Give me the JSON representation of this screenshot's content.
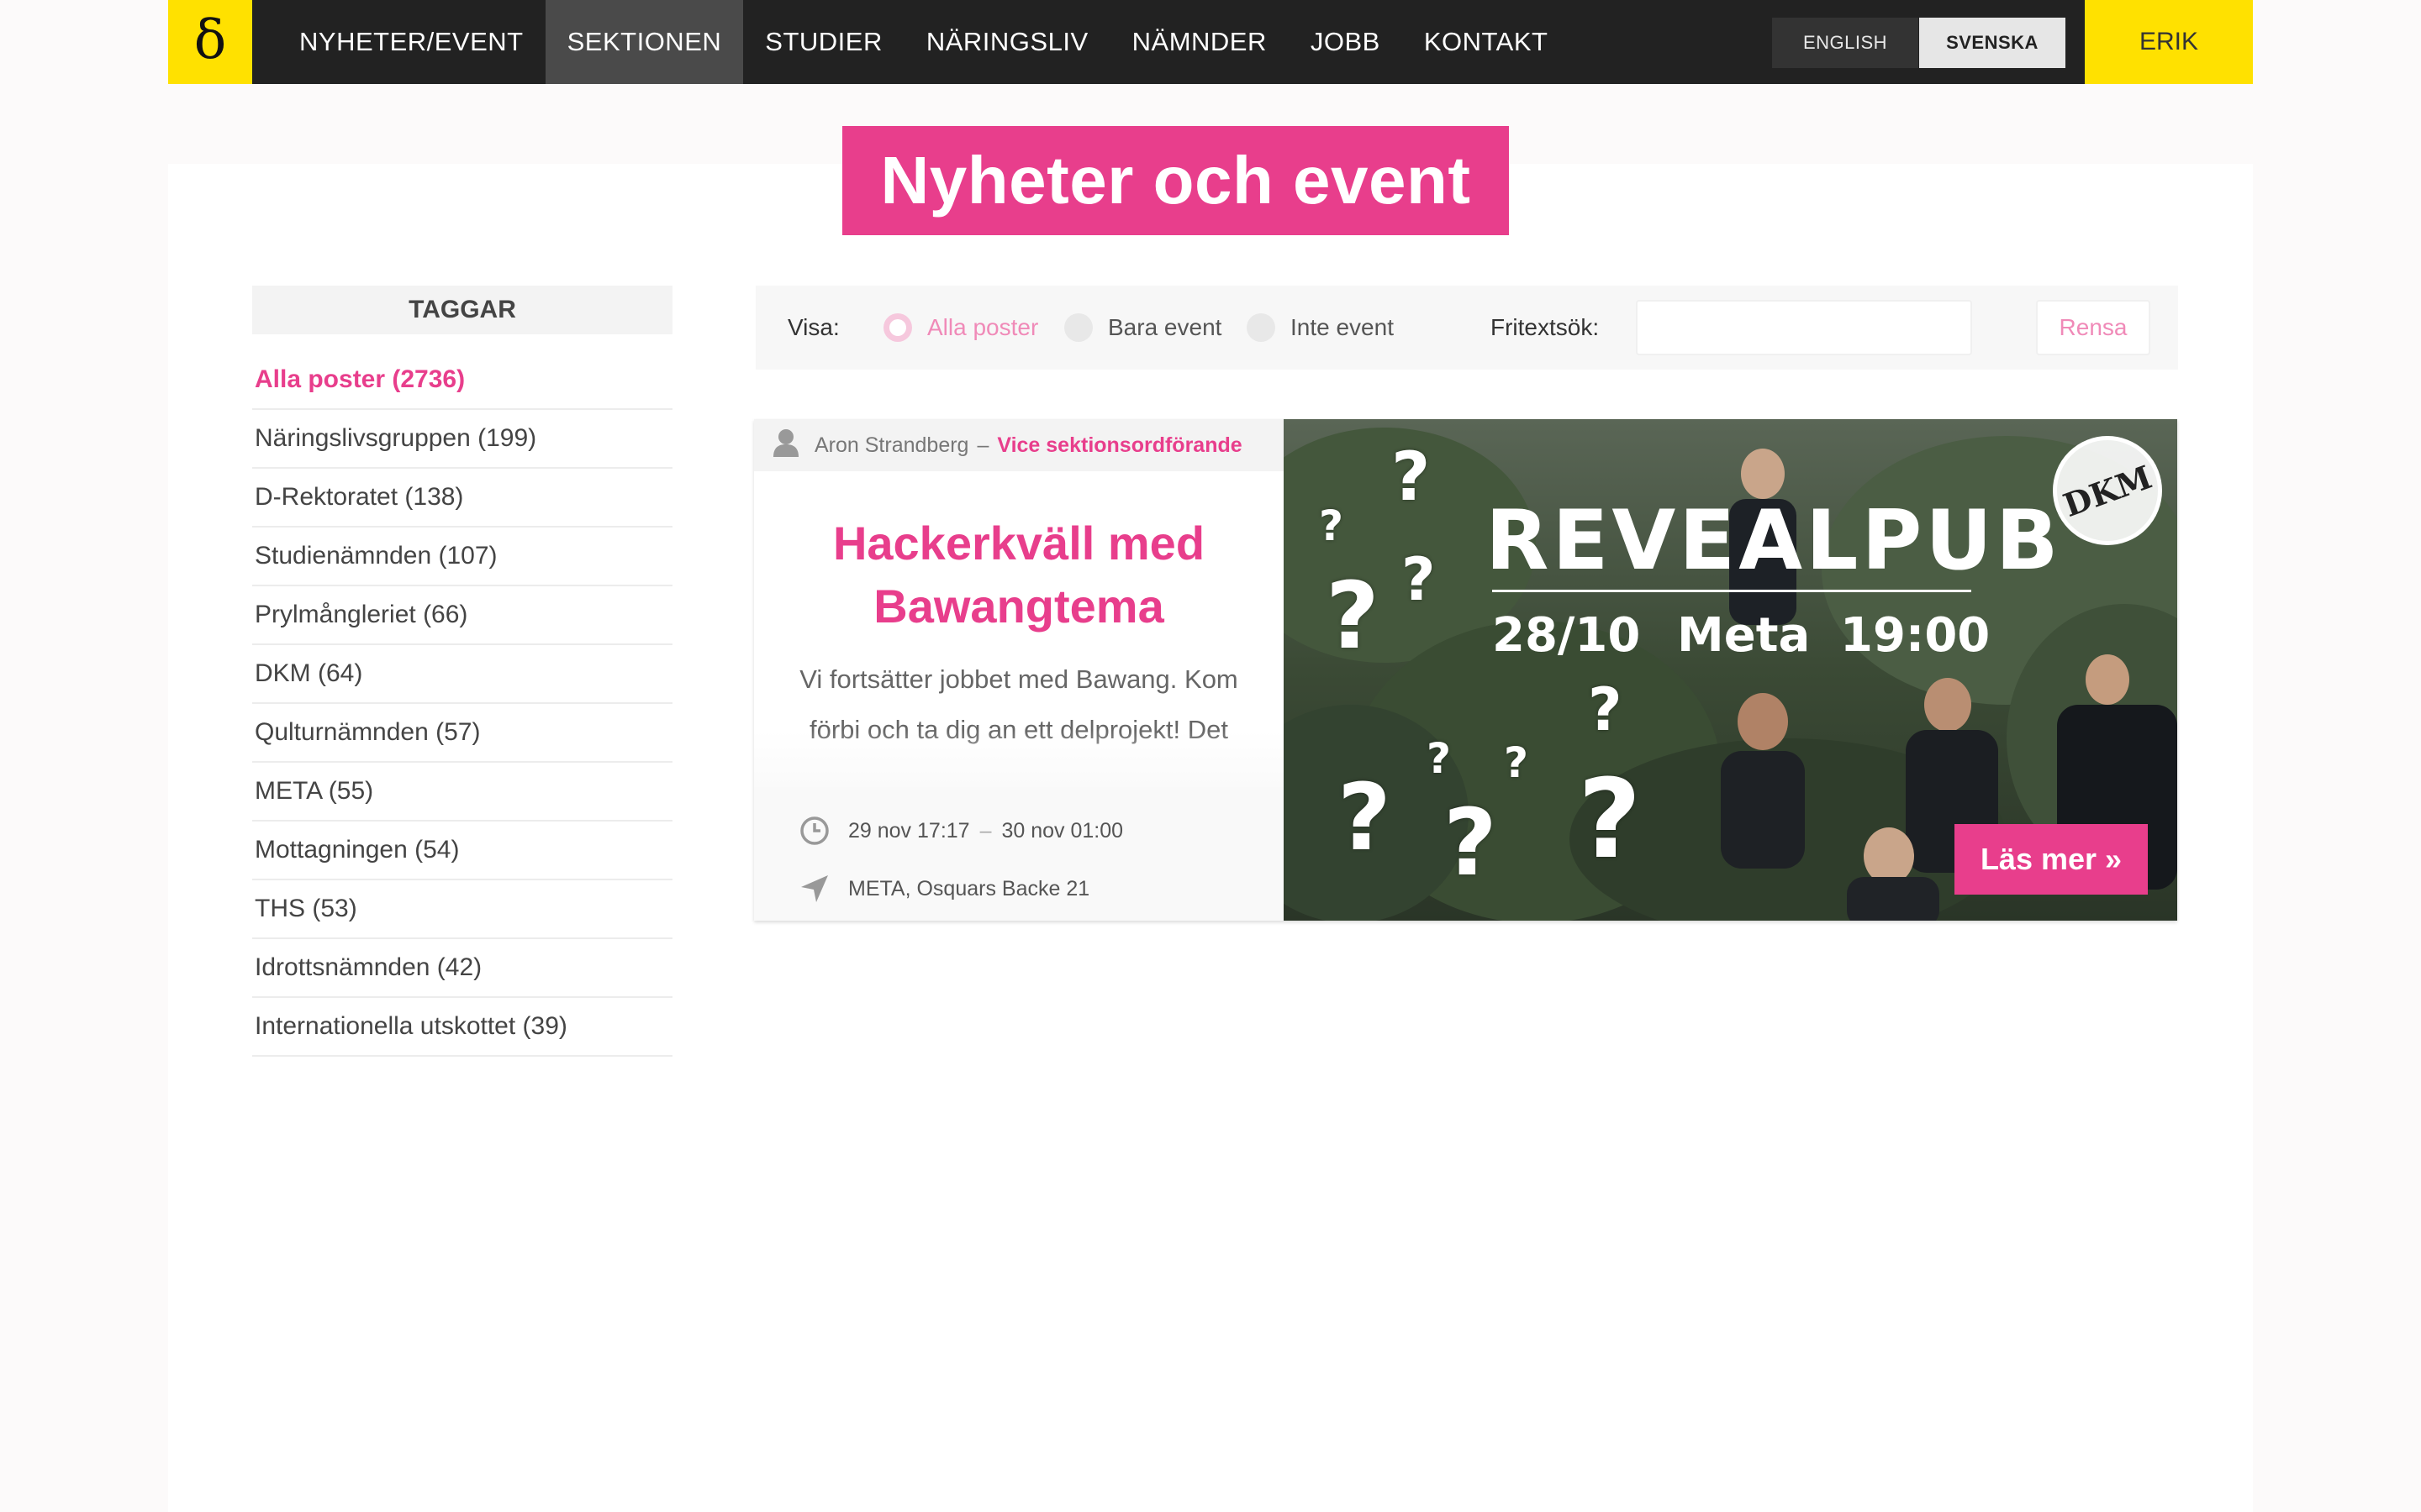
{
  "nav": {
    "logo": "δ",
    "items": [
      {
        "label": "NYHETER/EVENT",
        "active": false
      },
      {
        "label": "SEKTIONEN",
        "active": true
      },
      {
        "label": "STUDIER",
        "active": false
      },
      {
        "label": "NÄRINGSLIV",
        "active": false
      },
      {
        "label": "NÄMNDER",
        "active": false
      },
      {
        "label": "JOBB",
        "active": false
      },
      {
        "label": "KONTAKT",
        "active": false
      }
    ],
    "lang_en": "ENGLISH",
    "lang_sv": "SVENSKA",
    "user": "ERIK"
  },
  "page": {
    "title": "Nyheter och event"
  },
  "sidebar": {
    "heading": "TAGGAR",
    "tags": [
      "Alla poster (2736)",
      "Näringslivsgruppen (199)",
      "D-Rektoratet (138)",
      "Studienämnden (107)",
      "Prylmångleriet (66)",
      "DKM (64)",
      "Qulturnämnden (57)",
      "META (55)",
      "Mottagningen (54)",
      "THS (53)",
      "Idrottsnämnden (42)",
      "Internationella utskottet (39)"
    ]
  },
  "filter": {
    "show_label": "Visa:",
    "options": [
      "Alla poster",
      "Bara event",
      "Inte event"
    ],
    "selected": "Alla poster",
    "search_label": "Fritextsök:",
    "search_value": "",
    "clear_label": "Rensa"
  },
  "post": {
    "author": "Aron Strandberg",
    "separator": "–",
    "role": "Vice sektionsordförande",
    "title_line1": "Hackerkväll med",
    "title_line2": "Bawangtema",
    "body": "Vi fortsätter jobbet med Bawang. Kom förbi och ta dig an ett delprojekt! Det finns mängder med olika saker att göra",
    "start": "29 nov 17:17",
    "end": "30 nov 01:00",
    "time_sep": "–",
    "location": "META, Osquars Backe 21",
    "image": {
      "headline": "REVEALPUB",
      "date": "28/10",
      "place": "Meta",
      "time": "19:00",
      "stamp": "DKM",
      "question_mark": "?"
    },
    "read_more": "Läs mer »"
  },
  "colors": {
    "accent": "#e83e8c",
    "nav_bg": "#222222",
    "logo_bg": "#ffe100"
  }
}
